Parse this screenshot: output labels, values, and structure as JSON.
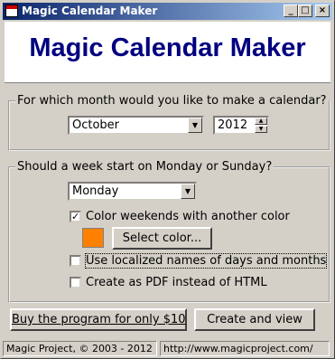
{
  "window": {
    "title": "Magic Calendar Maker",
    "controls": {
      "minimize": "_",
      "maximize": "□",
      "close": "×"
    }
  },
  "banner": {
    "title": "Magic Calendar Maker"
  },
  "month_group": {
    "legend": "For which month would you like to make a calendar?",
    "month": "October",
    "year": "2012"
  },
  "week_group": {
    "legend": "Should a week start on Monday or Sunday?",
    "start_day": "Monday",
    "color_weekends": {
      "label": "Color weekends with another color",
      "checked": true
    },
    "weekend_color": "#ff8000",
    "select_color_button": "Select color...",
    "localized_names": {
      "label": "Use localized names of days and months",
      "checked": false
    },
    "pdf_output": {
      "label": "Create as PDF instead of HTML",
      "checked": false
    }
  },
  "buttons": {
    "buy": "Buy the program for only $10",
    "create": "Create and view"
  },
  "status": {
    "copyright": "Magic Project, © 2003 - 2012",
    "url": "http://www.magicproject.com/"
  }
}
